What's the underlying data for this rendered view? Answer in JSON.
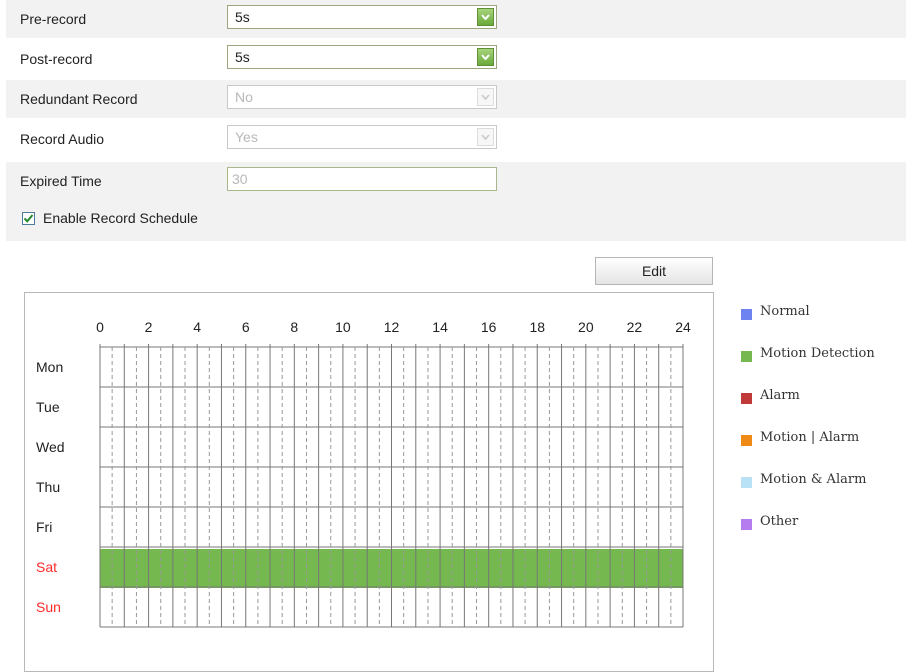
{
  "settings": {
    "pre_record": {
      "label": "Pre-record",
      "value": "5s"
    },
    "post_record": {
      "label": "Post-record",
      "value": "5s"
    },
    "redundant_record": {
      "label": "Redundant Record",
      "value": "No"
    },
    "record_audio": {
      "label": "Record Audio",
      "value": "Yes"
    },
    "expired_time": {
      "label": "Expired Time",
      "value": "30"
    },
    "enable_schedule": {
      "label": "Enable Record Schedule",
      "checked": true
    }
  },
  "schedule": {
    "edit_label": "Edit",
    "hour_ticks": [
      "0",
      "2",
      "4",
      "6",
      "8",
      "10",
      "12",
      "14",
      "16",
      "18",
      "20",
      "22",
      "24"
    ],
    "days": [
      {
        "name": "Mon",
        "weekend": false,
        "type": "none"
      },
      {
        "name": "Tue",
        "weekend": false,
        "type": "none"
      },
      {
        "name": "Wed",
        "weekend": false,
        "type": "none"
      },
      {
        "name": "Thu",
        "weekend": false,
        "type": "none"
      },
      {
        "name": "Fri",
        "weekend": false,
        "type": "none"
      },
      {
        "name": "Sat",
        "weekend": true,
        "type": "motion",
        "start": 0,
        "end": 24
      },
      {
        "name": "Sun",
        "weekend": true,
        "type": "none"
      }
    ],
    "weekend_color": "#ff2a2a"
  },
  "legend": [
    {
      "label": "Normal",
      "color": "#6e82f0",
      "icon": "normal-swatch"
    },
    {
      "label": "Motion Detection",
      "color": "#74b84f",
      "icon": "motion-detection-swatch"
    },
    {
      "label": "Alarm",
      "color": "#c03a3a",
      "icon": "alarm-swatch"
    },
    {
      "label": "Motion | Alarm",
      "color": "#f08a16",
      "icon": "motion-or-alarm-swatch"
    },
    {
      "label": "Motion & Alarm",
      "color": "#b9e2f7",
      "icon": "motion-and-alarm-swatch"
    },
    {
      "label": "Other",
      "color": "#b57cf0",
      "icon": "other-swatch"
    }
  ]
}
